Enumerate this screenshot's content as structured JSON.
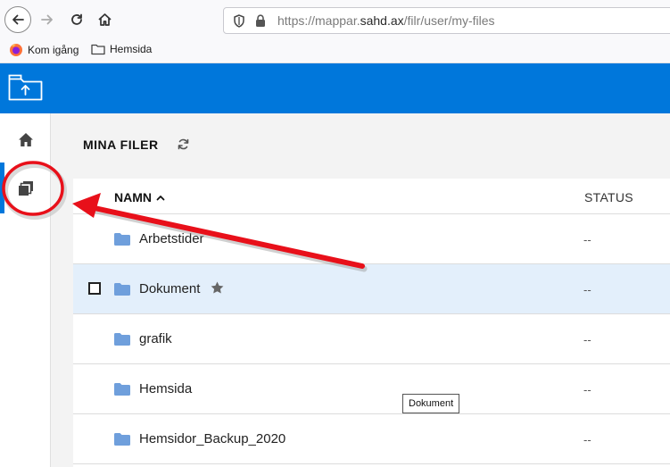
{
  "browser": {
    "url_prefix": "https://mappar.",
    "url_domain": "sahd.ax",
    "url_path": "/filr/user/my-files",
    "bookmarks": [
      {
        "label": "Kom igång",
        "icon": "firefox-icon"
      },
      {
        "label": "Hemsida",
        "icon": "folder-icon"
      }
    ]
  },
  "app": {
    "brand_color": "#0077db",
    "rail": [
      {
        "icon": "home-icon"
      },
      {
        "icon": "my-files-icon",
        "active": true
      }
    ]
  },
  "main": {
    "title": "MINA FILER",
    "columns": {
      "name": "NAMN",
      "status": "STATUS"
    },
    "rows": [
      {
        "name": "Arbetstider",
        "status": "--"
      },
      {
        "name": "Dokument",
        "status": "--",
        "selected": true,
        "favorite": true
      },
      {
        "name": "grafik",
        "status": "--"
      },
      {
        "name": "Hemsida",
        "status": "--"
      },
      {
        "name": "Hemsidor_Backup_2020",
        "status": "--"
      }
    ],
    "tooltip": "Dokument"
  },
  "annotation": {
    "color": "#e8101a"
  }
}
